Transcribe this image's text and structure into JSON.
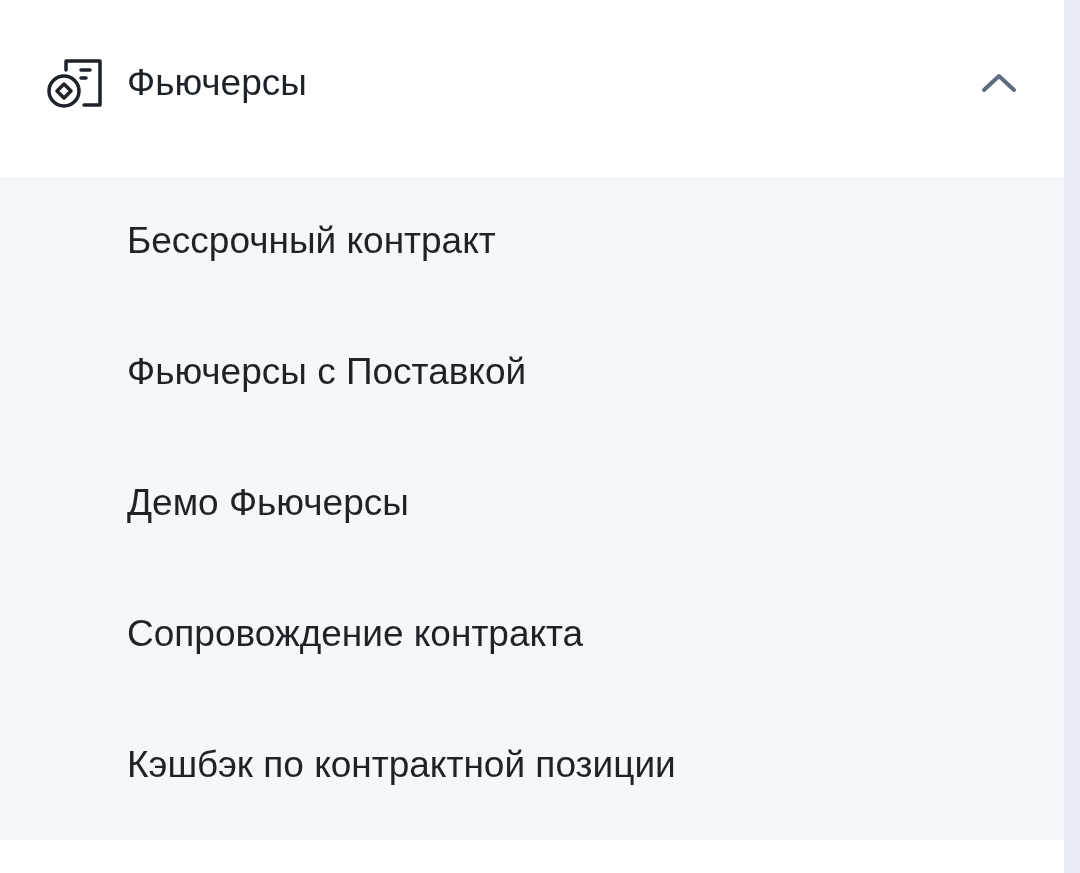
{
  "menu_section": {
    "label": "Фьючерсы",
    "expanded": true,
    "items": [
      {
        "label": "Бессрочный контракт"
      },
      {
        "label": "Фьючерсы с Поставкой"
      },
      {
        "label": "Демо Фьючерсы"
      },
      {
        "label": "Сопровождение контракта"
      },
      {
        "label": "Кэшбэк по контрактной позиции"
      }
    ]
  }
}
